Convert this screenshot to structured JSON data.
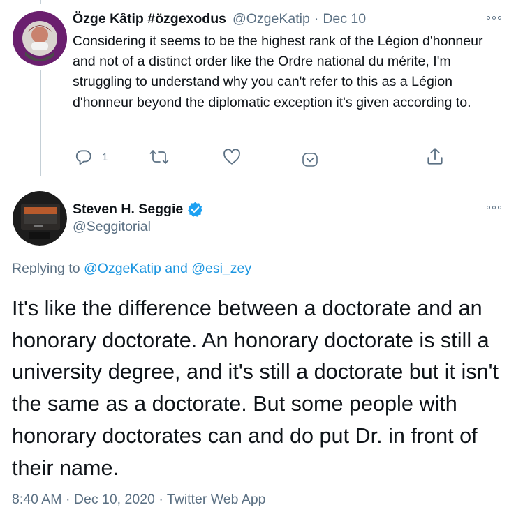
{
  "reply_tweet": {
    "author_name": "Özge Kâtip #özgexodus",
    "author_handle": "@OzgeKatip",
    "separator": "·",
    "date": "Dec 10",
    "text": "Considering it seems to be the highest rank of the Légion d'honneur and not of a distinct order like the Ordre national du mérite, I'm struggling to understand why you can't refer to this as a Légion d'honneur beyond the diplomatic exception it's given according to.",
    "reply_count": "1",
    "avatar_ring_color": "#6a1f6e"
  },
  "main_tweet": {
    "author_name": "Steven H. Seggie",
    "author_handle": "@Seggitorial",
    "verified_badge_color": "#1da1f2",
    "replying_prefix": "Replying to",
    "replying_user1": "@OzgeKatip",
    "replying_and": "and",
    "replying_user2": "@esi_zey",
    "text": "It's like the difference between a doctorate and an honorary doctorate. An honorary doctorate is still a university degree, and it's still a doctorate but it isn't the same as a doctorate. But some people with honorary doctorates can and do put Dr. in front of their name.",
    "time": "8:40 AM",
    "date": "Dec 10, 2020",
    "source": "Twitter Web App"
  }
}
